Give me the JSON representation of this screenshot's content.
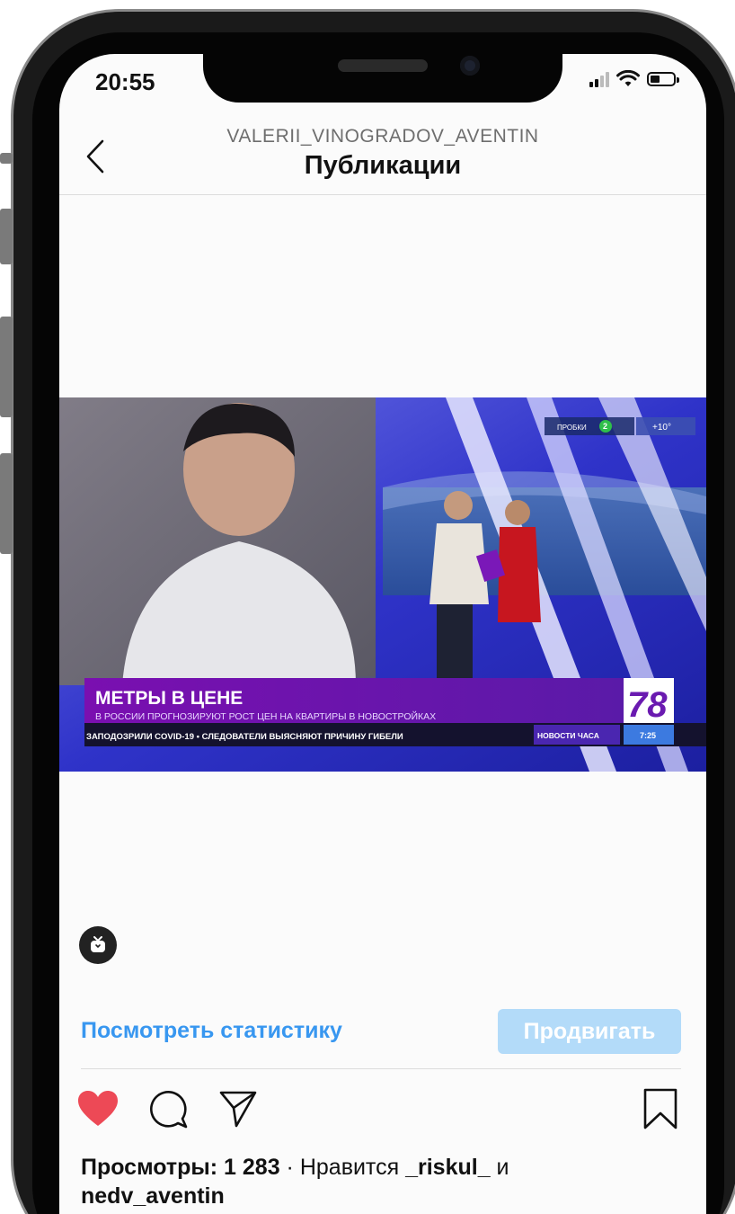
{
  "status_bar": {
    "time": "20:55"
  },
  "header": {
    "username": "VALERII_VINOGRADOV_AVENTIN",
    "title": "Публикации"
  },
  "video": {
    "headline": "МЕТРЫ В ЦЕНЕ",
    "subheadline": "В РОССИИ ПРОГНОЗИРУЮТ РОСТ ЦЕН НА КВАРТИРЫ В НОВОСТРОЙКАХ",
    "ticker": "ЗАПОДОЗРИЛИ COVID-19  •  СЛЕДОВАТЕЛИ ВЫЯСНЯЮТ ПРИЧИНУ ГИБЕЛИ",
    "section": "НОВОСТИ ЧАСА",
    "channel": "78",
    "clock": "7:25",
    "traffic_label": "ПРОБКИ",
    "traffic_level": "2",
    "weather": "+10°"
  },
  "insights": {
    "stats_label": "Посмотреть статистику",
    "promote_label": "Продвигать"
  },
  "meta": {
    "views_label": "Просмотры: 1 283",
    "sep": " · ",
    "liked_prefix": "Нравится ",
    "liked_user": "_riskul_",
    "liked_and": " и",
    "liked_user2": "nedv_aventin"
  },
  "icons": {
    "like": "heart-icon",
    "comment": "comment-icon",
    "share": "send-icon",
    "save": "bookmark-icon",
    "igtv": "igtv-icon",
    "back": "chevron-left-icon"
  },
  "colors": {
    "like": "#ed4956",
    "link": "#3897f0",
    "promote_bg": "#b3dbf9"
  }
}
